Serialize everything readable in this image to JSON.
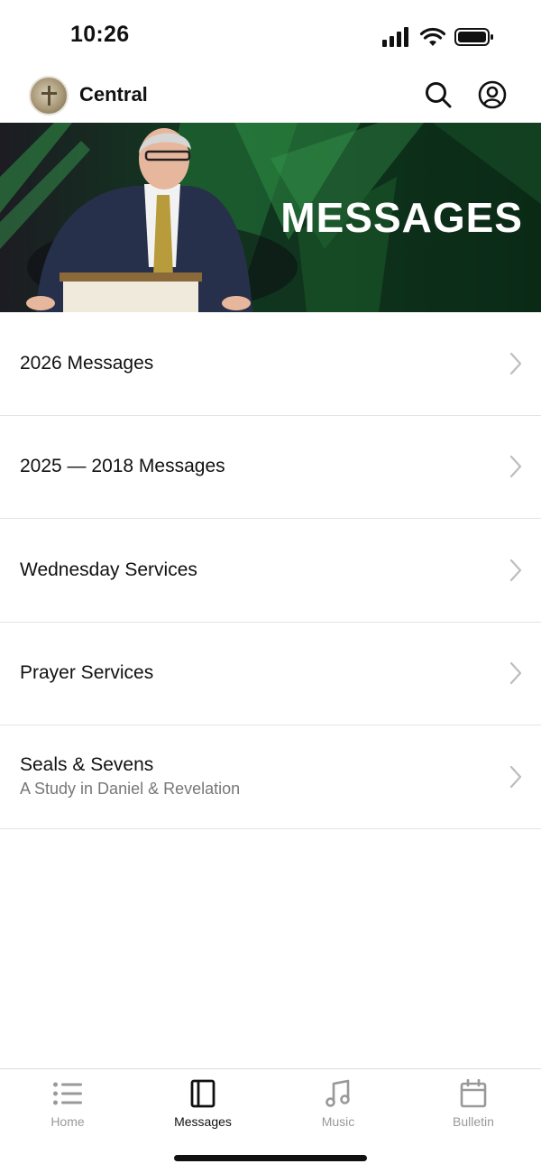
{
  "status_bar": {
    "time": "10:26"
  },
  "header": {
    "title": "Central"
  },
  "banner": {
    "title": "MESSAGES"
  },
  "menu": [
    {
      "title": "2026 Messages",
      "subtitle": ""
    },
    {
      "title": "2025 — 2018 Messages",
      "subtitle": ""
    },
    {
      "title": "Wednesday Services",
      "subtitle": ""
    },
    {
      "title": "Prayer Services",
      "subtitle": ""
    },
    {
      "title": "Seals & Sevens",
      "subtitle": "A Study in Daniel & Revelation"
    }
  ],
  "tabs": [
    {
      "label": "Home",
      "icon": "list-icon",
      "active": false
    },
    {
      "label": "Messages",
      "icon": "book-icon",
      "active": true
    },
    {
      "label": "Music",
      "icon": "music-note-icon",
      "active": false
    },
    {
      "label": "Bulletin",
      "icon": "calendar-icon",
      "active": false
    }
  ],
  "colors": {
    "banner_green": "#0c2f1a",
    "accent_green": "#2e8a44",
    "inactive_tab": "#999999",
    "active_tab": "#111111"
  }
}
